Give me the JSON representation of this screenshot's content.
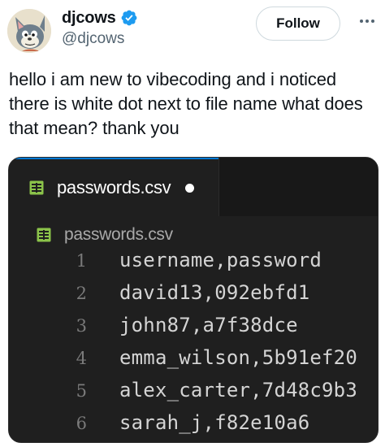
{
  "author": {
    "display_name": "djcows",
    "handle": "@djcows",
    "verified": true,
    "verified_color": "#1d9bf0"
  },
  "actions": {
    "follow_label": "Follow",
    "more_icon": "more-horizontal-icon"
  },
  "tweet": {
    "text": "hello i am new to vibecoding and i noticed there is white dot next to file name what does that mean? thank you"
  },
  "editor": {
    "tab": {
      "label": "passwords.csv",
      "icon": "csv-file-icon",
      "unsaved_indicator": true
    },
    "breadcrumb": {
      "label": "passwords.csv",
      "icon": "csv-file-icon"
    },
    "lines": [
      {
        "number": "1",
        "text": "username,password"
      },
      {
        "number": "2",
        "text": "david13,092ebfd1"
      },
      {
        "number": "3",
        "text": "john87,a7f38dce"
      },
      {
        "number": "4",
        "text": "emma_wilson,5b91ef20"
      },
      {
        "number": "5",
        "text": "alex_carter,7d48c9b3"
      },
      {
        "number": "6",
        "text": "sarah_j,f82e10a6"
      }
    ]
  },
  "colors": {
    "accent_tab_border": "#0078d4",
    "csv_icon": "#8bc34a",
    "editor_background": "#1f1f1f"
  }
}
